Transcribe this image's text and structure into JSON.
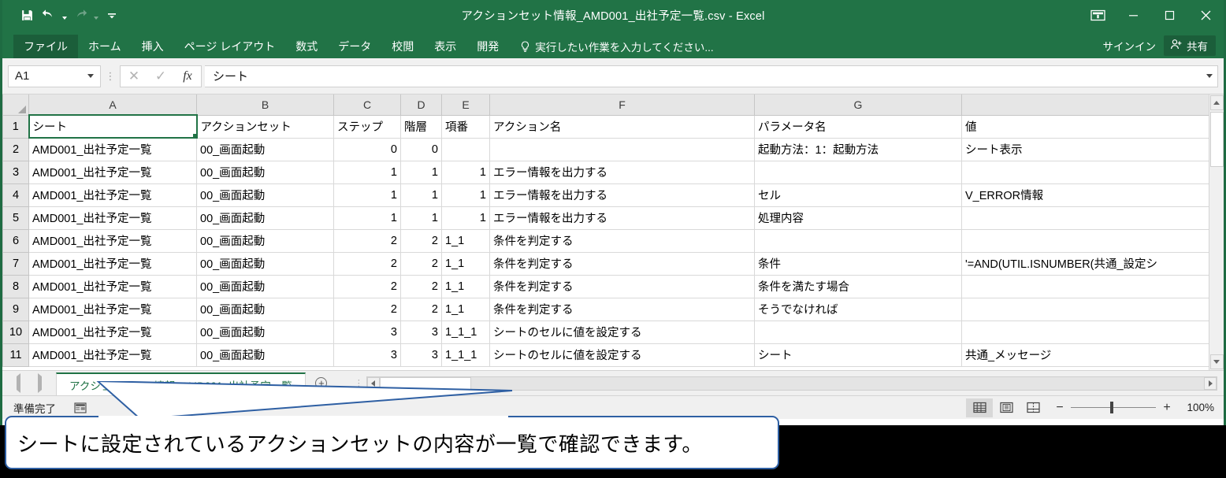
{
  "titlebar": {
    "document_title": "アクションセット情報_AMD001_出社予定一覧.csv - Excel",
    "qat": [
      {
        "name": "save",
        "icon": "save-icon"
      },
      {
        "name": "undo",
        "icon": "undo-icon"
      },
      {
        "name": "redo",
        "icon": "redo-icon"
      },
      {
        "name": "customize-quick-access-toolbar",
        "icon": "overflow-icon"
      }
    ],
    "ribbon_display_options": "ribbon-display-options-icon",
    "minimize": "−",
    "maximize": "□",
    "close": "✕"
  },
  "ribbon": {
    "tabs": [
      "ファイル",
      "ホーム",
      "挿入",
      "ページ レイアウト",
      "数式",
      "データ",
      "校閲",
      "表示",
      "開発"
    ],
    "tellme_placeholder": "実行したい作業を入力してください...",
    "signin_label": "サインイン",
    "share_label": "共有"
  },
  "formula_bar": {
    "name_box": "A1",
    "cancel": "✕",
    "enter": "✓",
    "insert_function": "fx",
    "content": "シート"
  },
  "grid": {
    "columns": [
      "A",
      "B",
      "C",
      "D",
      "E",
      "F",
      "G",
      ""
    ],
    "row_numbers": [
      "1",
      "2",
      "3",
      "4",
      "5",
      "6",
      "7",
      "8",
      "9",
      "10",
      "11"
    ],
    "selected_cell": "A1",
    "rows": [
      {
        "n": "1",
        "a": "シート",
        "b": "アクションセット",
        "c": "ステップ",
        "d": "階層",
        "e": "項番",
        "f": "アクション名",
        "g": "パラメータ名",
        "h": "値",
        "c_align": "left",
        "d_align": "left",
        "e_align": "left"
      },
      {
        "n": "2",
        "a": "AMD001_出社予定一覧",
        "b": "00_画面起動",
        "c": "0",
        "d": "0",
        "e": "",
        "f": "",
        "g": "起動方法：1：起動方法",
        "h": "シート表示",
        "c_align": "right",
        "d_align": "right",
        "e_align": "right"
      },
      {
        "n": "3",
        "a": "AMD001_出社予定一覧",
        "b": "00_画面起動",
        "c": "1",
        "d": "1",
        "e": "1",
        "f": "エラー情報を出力する",
        "g": "",
        "h": "",
        "c_align": "right",
        "d_align": "right",
        "e_align": "right"
      },
      {
        "n": "4",
        "a": "AMD001_出社予定一覧",
        "b": "00_画面起動",
        "c": "1",
        "d": "1",
        "e": "1",
        "f": "エラー情報を出力する",
        "g": "セル",
        "h": "V_ERROR情報",
        "c_align": "right",
        "d_align": "right",
        "e_align": "right"
      },
      {
        "n": "5",
        "a": "AMD001_出社予定一覧",
        "b": "00_画面起動",
        "c": "1",
        "d": "1",
        "e": "1",
        "f": "エラー情報を出力する",
        "g": "処理内容",
        "h": "",
        "c_align": "right",
        "d_align": "right",
        "e_align": "right"
      },
      {
        "n": "6",
        "a": "AMD001_出社予定一覧",
        "b": "00_画面起動",
        "c": "2",
        "d": "2",
        "e": "1_1",
        "f": "条件を判定する",
        "g": "",
        "h": "",
        "c_align": "right",
        "d_align": "right",
        "e_align": "left"
      },
      {
        "n": "7",
        "a": "AMD001_出社予定一覧",
        "b": "00_画面起動",
        "c": "2",
        "d": "2",
        "e": "1_1",
        "f": "条件を判定する",
        "g": "条件",
        "h": "'=AND(UTIL.ISNUMBER(共通_設定シ",
        "c_align": "right",
        "d_align": "right",
        "e_align": "left"
      },
      {
        "n": "8",
        "a": "AMD001_出社予定一覧",
        "b": "00_画面起動",
        "c": "2",
        "d": "2",
        "e": "1_1",
        "f": "条件を判定する",
        "g": "条件を満たす場合",
        "h": "",
        "c_align": "right",
        "d_align": "right",
        "e_align": "left"
      },
      {
        "n": "9",
        "a": "AMD001_出社予定一覧",
        "b": "00_画面起動",
        "c": "2",
        "d": "2",
        "e": "1_1",
        "f": "条件を判定する",
        "g": "そうでなければ",
        "h": "",
        "c_align": "right",
        "d_align": "right",
        "e_align": "left"
      },
      {
        "n": "10",
        "a": "AMD001_出社予定一覧",
        "b": "00_画面起動",
        "c": "3",
        "d": "3",
        "e": "1_1_1",
        "f": "シートのセルに値を設定する",
        "g": "",
        "h": "",
        "c_align": "right",
        "d_align": "right",
        "e_align": "left"
      },
      {
        "n": "11",
        "a": "AMD001_出社予定一覧",
        "b": "00_画面起動",
        "c": "3",
        "d": "3",
        "e": "1_1_1",
        "f": "シートのセルに値を設定する",
        "g": "シート",
        "h": "共通_メッセージ",
        "c_align": "right",
        "d_align": "right",
        "e_align": "left"
      }
    ]
  },
  "sheet_tabs": {
    "active_tab": "アクションセット情報_AMD001_出社予定一覧",
    "add_sheet": "+"
  },
  "statusbar": {
    "status": "準備完了",
    "macro_record": "record-macro-icon",
    "views": [
      "normal-view-icon",
      "page-layout-view-icon",
      "page-break-preview-icon"
    ],
    "zoom_out": "−",
    "zoom_in": "+",
    "zoom_level": "100%"
  },
  "callout": {
    "text": "シートに設定されているアクションセットの内容が一覧で確認できます。",
    "border_color": "#2e5fa3"
  },
  "colors": {
    "excel_green": "#217346",
    "excel_green_dark": "#1b5e3a",
    "grid_line": "#d9d9d9",
    "header_grey": "#e6e6e6"
  }
}
